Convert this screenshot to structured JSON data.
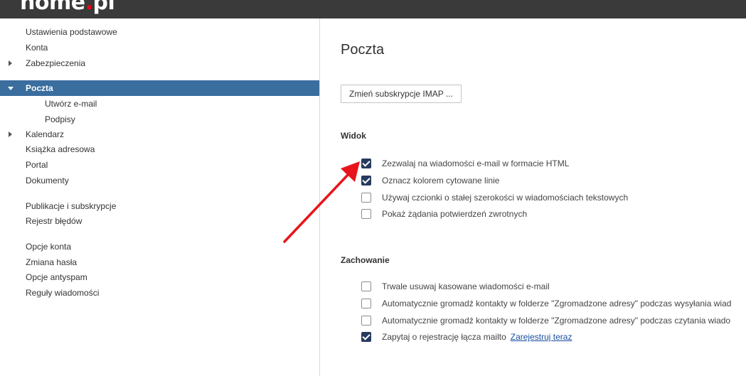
{
  "header": {
    "logo_main": "home",
    "logo_dot": ".",
    "logo_tld": "pl"
  },
  "sidebar": {
    "items": [
      {
        "label": "Ustawienia podstawowe"
      },
      {
        "label": "Konta"
      },
      {
        "label": "Zabezpieczenia"
      },
      {
        "label": "Poczta"
      },
      {
        "label": "Utwórz e-mail"
      },
      {
        "label": "Podpisy"
      },
      {
        "label": "Kalendarz"
      },
      {
        "label": "Książka adresowa"
      },
      {
        "label": "Portal"
      },
      {
        "label": "Dokumenty"
      },
      {
        "label": "Publikacje i subskrypcje"
      },
      {
        "label": "Rejestr błędów"
      },
      {
        "label": "Opcje konta"
      },
      {
        "label": "Zmiana hasła"
      },
      {
        "label": "Opcje antyspam"
      },
      {
        "label": "Reguły wiadomości"
      }
    ]
  },
  "main": {
    "title": "Poczta",
    "imap_button": "Zmień subskrypcje IMAP ...",
    "view_section": {
      "title": "Widok",
      "options": [
        {
          "label": "Zezwalaj na wiadomości e-mail w formacie HTML",
          "checked": true
        },
        {
          "label": "Oznacz kolorem cytowane linie",
          "checked": true
        },
        {
          "label": "Używaj czcionki o stałej szerokości w wiadomościach tekstowych",
          "checked": false
        },
        {
          "label": "Pokaż żądania potwierdzeń zwrotnych",
          "checked": false
        }
      ]
    },
    "behavior_section": {
      "title": "Zachowanie",
      "options": [
        {
          "label": "Trwale usuwaj kasowane wiadomości e-mail",
          "checked": false
        },
        {
          "label": "Automatycznie gromadź kontakty w folderze \"Zgromadzone adresy\" podczas wysyłania wiad",
          "checked": false
        },
        {
          "label": "Automatycznie gromadź kontakty w folderze \"Zgromadzone adresy\" podczas czytania wiado",
          "checked": false
        },
        {
          "label": "Zapytaj o rejestrację łącza mailto",
          "checked": true,
          "link": "Zarejestruj teraz"
        }
      ]
    }
  },
  "colors": {
    "selected_nav": "#3a6e9f",
    "checkbox_checked": "#283a5e",
    "annotation_arrow": "#e8141b",
    "logo_accent": "#e30613"
  }
}
